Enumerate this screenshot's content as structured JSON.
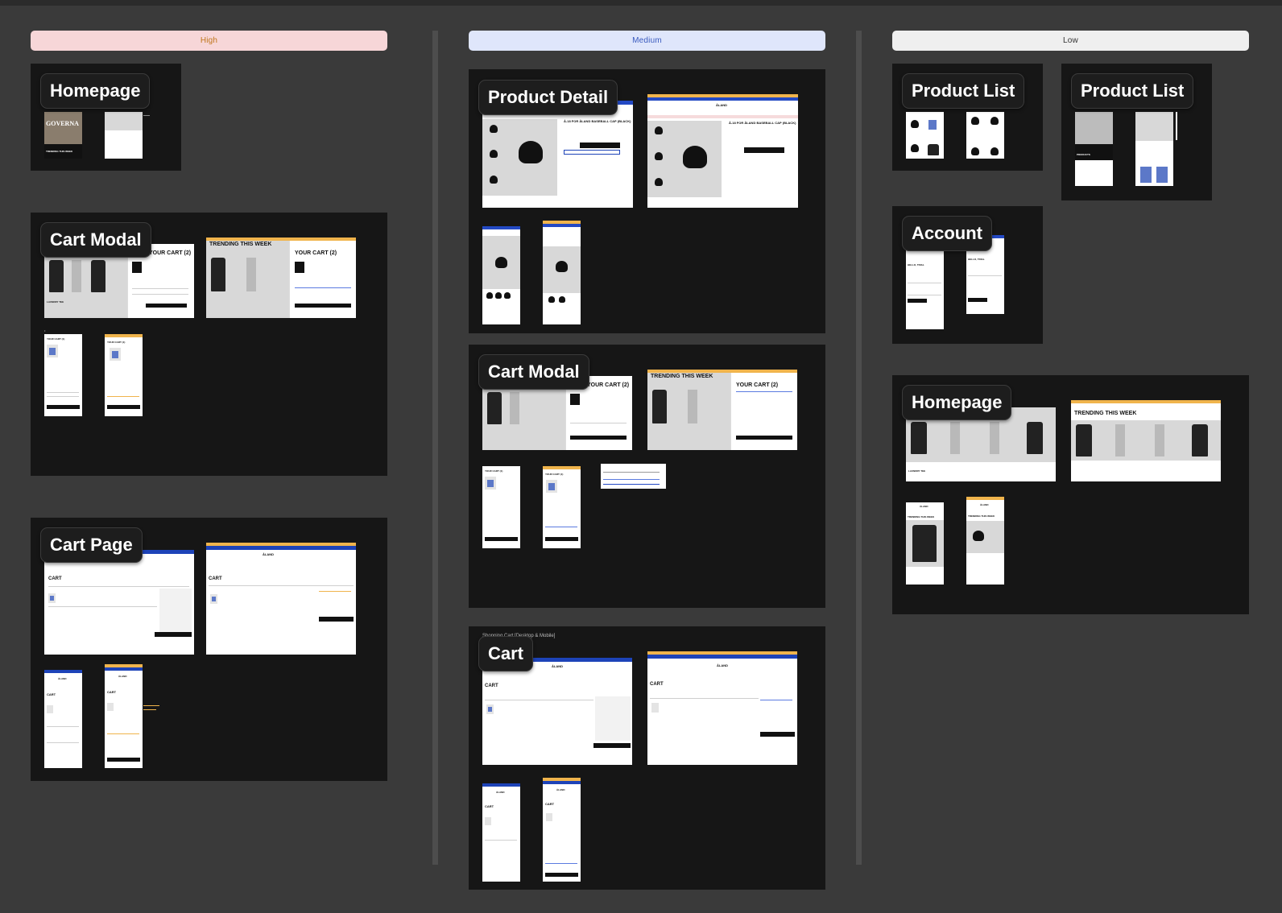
{
  "priorities": {
    "high": "High",
    "medium": "Medium",
    "low": "Low"
  },
  "colors": {
    "canvas": "#3a3a3a",
    "section_bg": "#161616",
    "high_bg": "#f7d6d8",
    "medium_bg": "#dfe6fb",
    "low_bg": "#efefef",
    "accent_orange": "#f0b44c",
    "brand_blue": "#1d43b8"
  },
  "sections": {
    "high_homepage": {
      "badge": "Homepage"
    },
    "high_cart_modal": {
      "badge": "Cart Modal"
    },
    "high_cart_page": {
      "badge": "Cart Page"
    },
    "medium_product_detail": {
      "badge": "Product Detail"
    },
    "medium_cart_modal": {
      "badge": "Cart Modal"
    },
    "medium_cart": {
      "badge": "Cart",
      "caption": "Shopping Cart [Desktop & Mobile]"
    },
    "low_product_list_1": {
      "badge": "Product List"
    },
    "low_product_list_2": {
      "badge": "Product List"
    },
    "low_account": {
      "badge": "Account"
    },
    "low_homepage": {
      "badge": "Homepage"
    }
  },
  "mock": {
    "cart_2": "YOUR CART (2)",
    "cart_1": "YOUR CART (1)",
    "cart": "CART",
    "trending": "TRENDING THIS WEEK",
    "brand": "ÅLAND",
    "cap_title": "Å-18 FOR ÅLAND BASEBALL CAP (BLACK)",
    "products": "PRODUCTS",
    "hello": "HELLO, TRIAL",
    "governa": "GOVERNA",
    "laundry": "LAUNDRY TEE",
    "checkout": "CHECKOUT"
  }
}
